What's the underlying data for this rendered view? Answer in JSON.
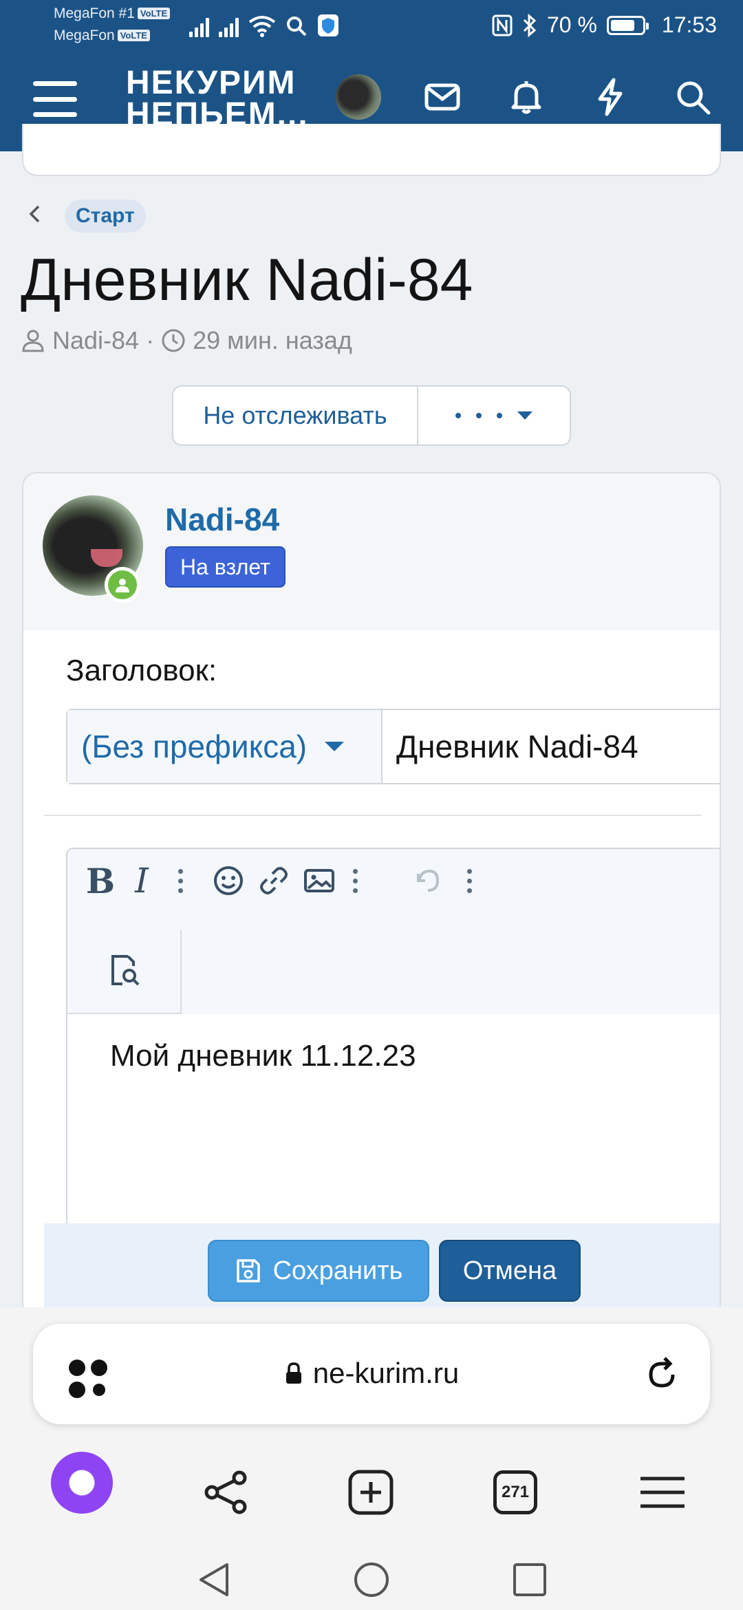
{
  "status_bar": {
    "carrier1": "MegaFon #1",
    "carrier2": "MegaFon",
    "volte": "VoLTE",
    "battery": "70 %",
    "time": "17:53"
  },
  "header": {
    "logo_line1": "НЕКУРИМ",
    "logo_line2": "НЕПЬЕМ..."
  },
  "breadcrumb": {
    "label": "Старт"
  },
  "thread": {
    "title": "Дневник Nadi-84",
    "author": "Nadi-84",
    "time_ago": "29 мин. назад"
  },
  "actions": {
    "unwatch": "Не отслеживать"
  },
  "post": {
    "username": "Nadi-84",
    "rank": "На взлет",
    "title_label": "Заголовок:",
    "prefix": "(Без префикса)",
    "title_value": "Дневник Nadi-84",
    "body": "Мой дневник 11.12.23",
    "save": "Сохранить",
    "cancel": "Отмена"
  },
  "browser": {
    "url": "ne-kurim.ru",
    "tabs_count": "271"
  },
  "colors": {
    "header_bg": "#1b5386",
    "link": "#1f6aa8",
    "rank_bg": "#3c64d8",
    "save_bg": "#4a9fe0",
    "cancel_bg": "#1f5f99",
    "online": "#6fbe44",
    "alice": "#8e44f2"
  }
}
